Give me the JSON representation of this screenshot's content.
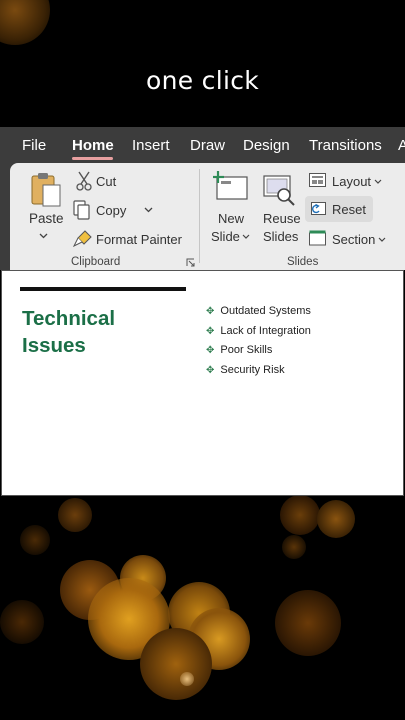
{
  "caption": "one click",
  "tabs": [
    "File",
    "Home",
    "Insert",
    "Draw",
    "Design",
    "Transitions",
    "A"
  ],
  "active_tab": "Home",
  "clipboard": {
    "paste": "Paste",
    "cut": "Cut",
    "copy": "Copy",
    "format_painter": "Format Painter",
    "group_label": "Clipboard"
  },
  "slides": {
    "new_slide_line1": "New",
    "new_slide_line2": "Slide",
    "reuse_line1": "Reuse",
    "reuse_line2": "Slides",
    "layout": "Layout",
    "reset": "Reset",
    "section": "Section",
    "group_label": "Slides"
  },
  "slide": {
    "title_line1": "Technical",
    "title_line2": "Issues",
    "bullets": [
      "Outdated Systems",
      "Lack of Integration",
      "Poor Skills",
      "Security Risk"
    ],
    "title_color": "#1b6f47"
  }
}
